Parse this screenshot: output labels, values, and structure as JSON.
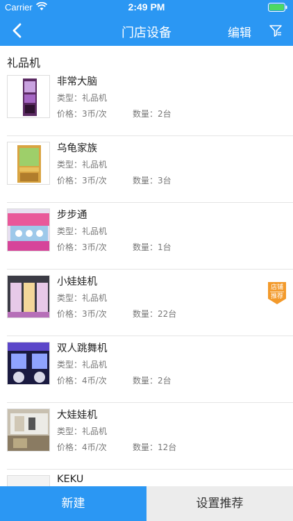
{
  "status": {
    "carrier": "Carrier",
    "time": "2:49 PM"
  },
  "nav": {
    "title": "门店设备",
    "edit_label": "编辑"
  },
  "section": {
    "title": "礼品机"
  },
  "labels": {
    "type": "类型：",
    "price": "价格：",
    "qty": "数量："
  },
  "badge": {
    "line1": "店铺",
    "line2": "推荐"
  },
  "items": [
    {
      "name": "非常大脑",
      "type": "礼品机",
      "price": "3币/次",
      "qty": "2台",
      "recommended": false
    },
    {
      "name": "乌龟家族",
      "type": "礼品机",
      "price": "3币/次",
      "qty": "3台",
      "recommended": false
    },
    {
      "name": "步步通",
      "type": "礼品机",
      "price": "3币/次",
      "qty": "1台",
      "recommended": false
    },
    {
      "name": "小娃娃机",
      "type": "礼品机",
      "price": "3币/次",
      "qty": "22台",
      "recommended": true
    },
    {
      "name": "双人跳舞机",
      "type": "礼品机",
      "price": "4币/次",
      "qty": "2台",
      "recommended": false
    },
    {
      "name": "大娃娃机",
      "type": "礼品机",
      "price": "4币/次",
      "qty": "12台",
      "recommended": false
    },
    {
      "name": "KEKU"
    }
  ],
  "bottom": {
    "new_label": "新建",
    "recommend_label": "设置推荐"
  },
  "colors": {
    "primary": "#2b97f3",
    "badge": "#f39a2b",
    "secondary_bg": "#ececec"
  }
}
